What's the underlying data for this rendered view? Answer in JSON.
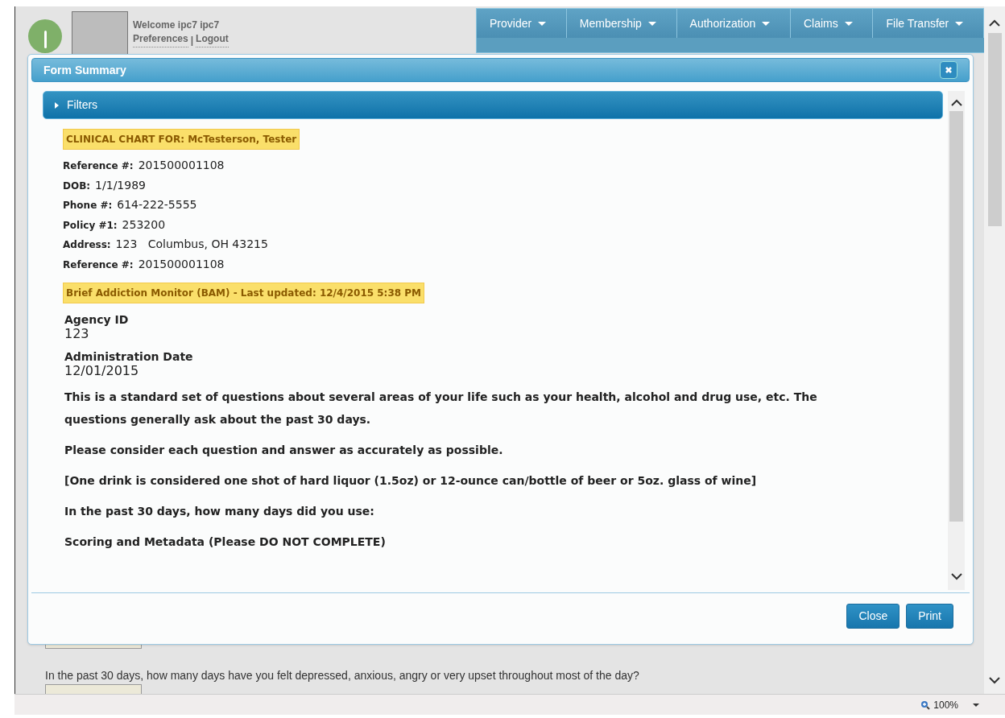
{
  "header": {
    "welcome": "Welcome ipc7 ipc7",
    "links": [
      "Preferences",
      "Logout"
    ],
    "separator": "|"
  },
  "nav": [
    {
      "label": "Provider"
    },
    {
      "label": "Membership"
    },
    {
      "label": "Authorization"
    },
    {
      "label": "Claims"
    },
    {
      "label": "File Transfer"
    }
  ],
  "modal": {
    "title": "Form Summary",
    "filters": {
      "label": "Filters",
      "expanded": false
    },
    "chart_banner": "CLINICAL CHART FOR: McTesterson, Tester",
    "fields": [
      {
        "label": "Reference #:",
        "value": "201500001108"
      },
      {
        "label": "DOB:",
        "value": "1/1/1989"
      },
      {
        "label": "Phone #:",
        "value": "614-222-5555"
      },
      {
        "label": "Policy #1:",
        "value": "253200"
      },
      {
        "label": "Address:",
        "value": "123   Columbus, OH 43215"
      },
      {
        "label": "Reference #:",
        "value": "201500001108"
      }
    ],
    "form_banner": "Brief Addiction Monitor (BAM) - Last updated: 12/4/2015 5:38 PM",
    "answers": [
      {
        "label": "Agency ID",
        "value": "123"
      },
      {
        "label": "Administration Date",
        "value": "12/01/2015"
      }
    ],
    "paragraphs": [
      "This is a standard set of questions about several areas of your life such as your health, alcohol and drug use, etc. The questions generally ask about the past 30 days.",
      "Please consider each question and answer as accurately as possible.",
      "[One drink is considered one shot of hard liquor (1.5oz) or 12-ounce can/bottle of beer or 5oz. glass of wine]",
      "In the past 30 days, how many days did you use:",
      "Scoring and Metadata (Please DO NOT COMPLETE)"
    ],
    "buttons": [
      "Close",
      "Print"
    ]
  },
  "page_question": "In the past 30 days, how many days have you felt depressed, anxious, angry or very upset throughout most of the day?",
  "status_bar": {
    "zoom": "100%"
  }
}
